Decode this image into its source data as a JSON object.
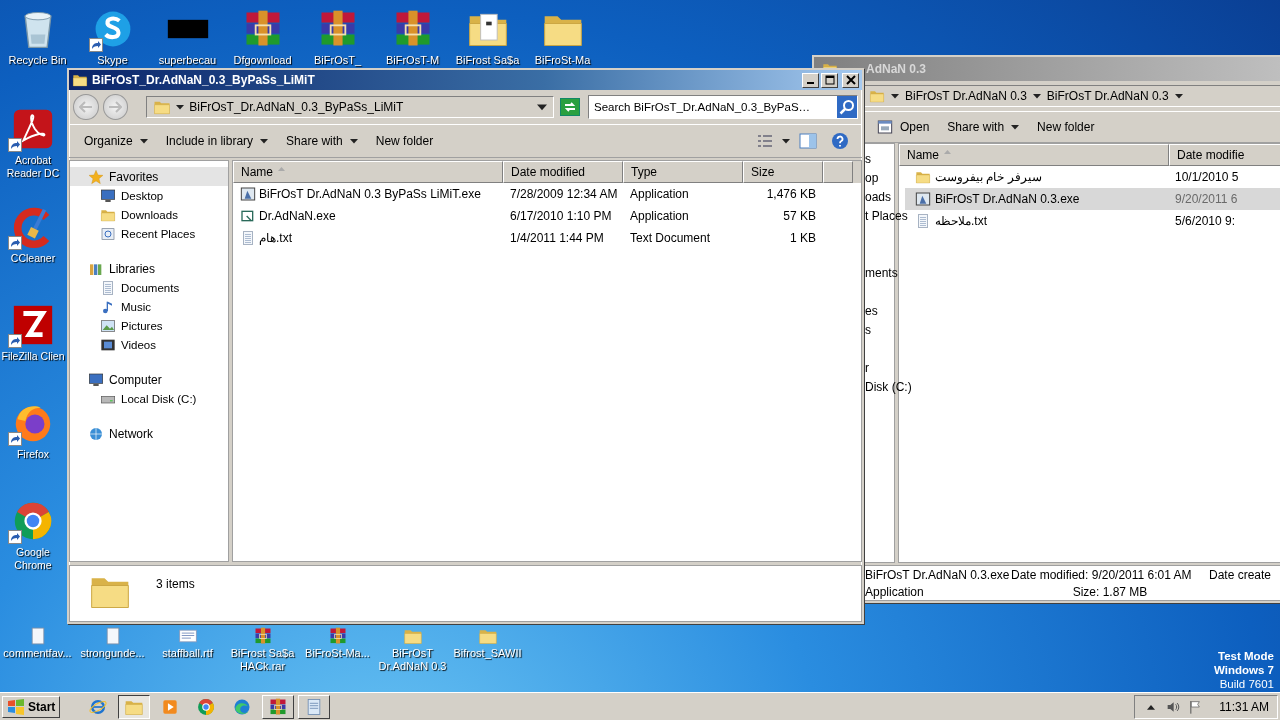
{
  "desktop": {
    "top_icons": [
      {
        "label": "Recycle Bin",
        "kind": "recycle",
        "shortcut": false
      },
      {
        "label": "Skype",
        "kind": "skype",
        "shortcut": true
      },
      {
        "label": "superbecau",
        "kind": "blank",
        "shortcut": false
      },
      {
        "label": "Dfgownload",
        "kind": "rar",
        "shortcut": false
      },
      {
        "label": "BiFrOsT_",
        "kind": "rar",
        "shortcut": false
      },
      {
        "label": "BiFrOsT-M",
        "kind": "rar",
        "shortcut": false
      },
      {
        "label": "BiFrost Sa$a",
        "kind": "folder_doc",
        "shortcut": false
      },
      {
        "label": "BiFroSt-Ma",
        "kind": "folder",
        "shortcut": false
      }
    ],
    "left_icons": [
      {
        "label": "Acrobat Reader DC",
        "kind": "acrobat",
        "shortcut": true
      },
      {
        "label": "CCleaner",
        "kind": "ccleaner",
        "shortcut": true
      },
      {
        "label": "FileZilla Clien",
        "kind": "filezilla",
        "shortcut": true
      },
      {
        "label": "Firefox",
        "kind": "firefox",
        "shortcut": true
      },
      {
        "label": "Google Chrome",
        "kind": "chrome",
        "shortcut": true
      }
    ],
    "bottom_icons": [
      {
        "label": "commentfav...",
        "kind": "file",
        "shortcut": false
      },
      {
        "label": "strongunde...",
        "kind": "file",
        "shortcut": false
      },
      {
        "label": "staffball.rtf",
        "kind": "rtf",
        "shortcut": false
      },
      {
        "label": "BiFrost Sa$a HACk.rar",
        "kind": "rar",
        "shortcut": false
      },
      {
        "label": "BiFroSt-Ma...",
        "kind": "rar",
        "shortcut": false
      },
      {
        "label": "BiFrOsT Dr.AdNaN 0.3",
        "kind": "folder",
        "shortcut": false
      },
      {
        "label": "Bifrost_SAWII",
        "kind": "folder",
        "shortcut": false
      }
    ],
    "os_notice": [
      {
        "text": "Test Mode",
        "emphasis": true
      },
      {
        "text": "Windows 7",
        "emphasis": true
      },
      {
        "text": "Build 7601",
        "emphasis": false
      }
    ]
  },
  "back_window": {
    "title": "AdNaN 0.3",
    "breadcrumb": [
      "BiFrOsT Dr.AdNaN 0.3",
      "BiFrOsT Dr.AdNaN 0.3"
    ],
    "toolbar": [
      {
        "label": "Open",
        "kind": "open"
      },
      {
        "label": "Share with",
        "kind": "menu"
      },
      {
        "label": "New folder",
        "kind": "plain"
      }
    ],
    "nav_fragments": [
      "s",
      "op",
      "oads",
      "t Places",
      "ments",
      "es",
      "s",
      "r",
      "Disk (C:)"
    ],
    "columns": [
      "Name",
      "Date modifie"
    ],
    "rows": [
      {
        "name": "سيرفر خام بيفروست",
        "date": "10/1/2010 5",
        "kind": "folder",
        "selected": false
      },
      {
        "name": "BiFrOsT Dr.AdNaN 0.3.exe",
        "date": "9/20/2011 6",
        "kind": "exe",
        "selected": true
      },
      {
        "name": "ملاحظه.txt",
        "date": "5/6/2010 9:",
        "kind": "txt",
        "selected": false
      }
    ],
    "details": {
      "name": "BiFrOsT Dr.AdNaN 0.3.exe",
      "type": "Application",
      "modified": "Date modified: 9/20/2011 6:01 AM",
      "size": "Size: 1.87 MB",
      "created": "Date create"
    }
  },
  "front_window": {
    "title": "BiFrOsT_Dr.AdNaN_0.3_ByPaSs_LiMiT",
    "address": "BiFrOsT_Dr.AdNaN_0.3_ByPaSs_LiMiT",
    "search": {
      "placeholder": "Search BiFrOsT_Dr.AdNaN_0.3_ByPaS…"
    },
    "toolbar": [
      {
        "label": "Organize",
        "kind": "menu"
      },
      {
        "label": "Include in library",
        "kind": "menu"
      },
      {
        "label": "Share with",
        "kind": "menu"
      },
      {
        "label": "New folder",
        "kind": "plain"
      }
    ],
    "nav": [
      {
        "label": "Favorites",
        "kind": "star",
        "selected": true,
        "children": [
          {
            "label": "Desktop",
            "kind": "desktop",
            "selected": false
          },
          {
            "label": "Downloads",
            "kind": "downloads",
            "selected": false
          },
          {
            "label": "Recent Places",
            "kind": "recent",
            "selected": false
          }
        ]
      },
      {
        "label": "Libraries",
        "kind": "library",
        "selected": false,
        "children": [
          {
            "label": "Documents",
            "kind": "documents",
            "selected": false
          },
          {
            "label": "Music",
            "kind": "music",
            "selected": false
          },
          {
            "label": "Pictures",
            "kind": "pictures",
            "selected": false
          },
          {
            "label": "Videos",
            "kind": "videos",
            "selected": false
          }
        ]
      },
      {
        "label": "Computer",
        "kind": "computer",
        "selected": false,
        "children": [
          {
            "label": "Local Disk (C:)",
            "kind": "disk",
            "selected": false
          }
        ]
      },
      {
        "label": "Network",
        "kind": "network",
        "selected": false
      }
    ],
    "columns": [
      "Name",
      "Date modified",
      "Type",
      "Size"
    ],
    "rows": [
      {
        "name": "BiFrOsT Dr.AdNaN 0.3 ByPaSs LiMiT.exe",
        "date": "7/28/2009 12:34 AM",
        "type": "Application",
        "size": "1,476 KB",
        "kind": "exe",
        "selected": false
      },
      {
        "name": "Dr.AdNaN.exe",
        "date": "6/17/2010 1:10 PM",
        "type": "Application",
        "size": "57 KB",
        "kind": "exe_small",
        "selected": false
      },
      {
        "name": "هام.txt",
        "date": "1/4/2011 1:44 PM",
        "type": "Text Document",
        "size": "1 KB",
        "kind": "txt",
        "selected": false
      }
    ],
    "status": "3 items"
  },
  "taskbar": {
    "start": "Start",
    "buttons": [
      {
        "kind": "ie",
        "selected": false,
        "open": false
      },
      {
        "kind": "explorer",
        "selected": true,
        "open": true
      },
      {
        "kind": "media",
        "selected": false,
        "open": false
      },
      {
        "kind": "chrome",
        "selected": false,
        "open": false
      },
      {
        "kind": "edge",
        "selected": false,
        "open": false
      },
      {
        "kind": "winrar",
        "selected": false,
        "open": true
      },
      {
        "kind": "notepad",
        "selected": false,
        "open": true
      }
    ],
    "tray": [
      {
        "kind": "caret_up"
      },
      {
        "kind": "speaker"
      },
      {
        "kind": "flag"
      }
    ],
    "clock": "11:31 AM"
  }
}
